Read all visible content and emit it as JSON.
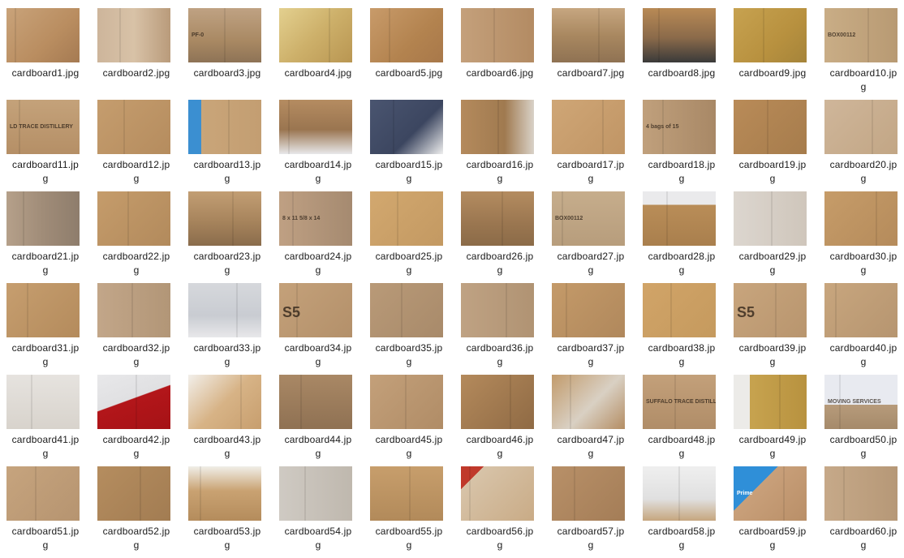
{
  "files": [
    {
      "name": "cardboard1.jpg",
      "bg": "linear-gradient(135deg,#c9a37a,#b98d60 60%,#a57a52)"
    },
    {
      "name": "cardboard2.jpg",
      "bg": "linear-gradient(90deg,#cdb59b,#d8c2a7 50%,#b99b7b)"
    },
    {
      "name": "cardboard3.jpg",
      "bg": "linear-gradient(180deg,#bfa283,#a98963 60%,#8e7356)",
      "text": "PF-0"
    },
    {
      "name": "cardboard4.jpg",
      "bg": "linear-gradient(135deg,#e3d08f,#cdb06a 50%,#b99652)"
    },
    {
      "name": "cardboard5.jpg",
      "bg": "linear-gradient(135deg,#c89b6a,#b3834f 60%,#a8784a)"
    },
    {
      "name": "cardboard6.jpg",
      "bg": "linear-gradient(90deg,#c4a07b,#b38b63)"
    },
    {
      "name": "cardboard7.jpg",
      "bg": "linear-gradient(180deg,#c6a680,#a98860 50%,#8f7253)"
    },
    {
      "name": "cardboard8.jpg",
      "bg": "linear-gradient(180deg,#b98a55,#8a6a4a 55%,#3a3a3a)"
    },
    {
      "name": "cardboard9.jpg",
      "bg": "linear-gradient(135deg,#c7a250,#b8913f 60%,#a5843a)"
    },
    {
      "name": "cardboard10.jpg",
      "bg": "linear-gradient(90deg,#c9ad86,#b89a73)",
      "text": "BOX00112"
    },
    {
      "name": "cardboard11.jpg",
      "bg": "linear-gradient(180deg,#c4a27a,#b58f66)",
      "text": "LD TRACE DISTILLERY"
    },
    {
      "name": "cardboard12.jpg",
      "bg": "linear-gradient(135deg,#c59d6e,#b58c5e)"
    },
    {
      "name": "cardboard13.jpg",
      "bg": "linear-gradient(90deg,#3b8fd1 0%,#3b8fd1 18%,#c9a579 18%,#c39e72)"
    },
    {
      "name": "cardboard14.jpg",
      "bg": "linear-gradient(180deg,#b58c61,#9a7550 55%,#e8e8ea)"
    },
    {
      "name": "cardboard15.jpg",
      "bg": "linear-gradient(135deg,#4a5570,#3c4660 60%,#eeeeee)"
    },
    {
      "name": "cardboard16.jpg",
      "bg": "linear-gradient(90deg,#b48a5c,#a07a50 60%,#d9d2c8)"
    },
    {
      "name": "cardboard17.jpg",
      "bg": "linear-gradient(135deg,#cfa676,#c09565)"
    },
    {
      "name": "cardboard18.jpg",
      "bg": "linear-gradient(90deg,#c0a07c,#a88866)",
      "text": "4 bags of 15"
    },
    {
      "name": "cardboard19.jpg",
      "bg": "linear-gradient(135deg,#b98b58,#a67c4c)"
    },
    {
      "name": "cardboard20.jpg",
      "bg": "linear-gradient(135deg,#cfb69a,#c2a685)"
    },
    {
      "name": "cardboard21.jpg",
      "bg": "linear-gradient(90deg,#b5a08a,#a08c78 50%,#8e7d6c)"
    },
    {
      "name": "cardboard22.jpg",
      "bg": "linear-gradient(135deg,#c59c6b,#b28a5c)"
    },
    {
      "name": "cardboard23.jpg",
      "bg": "linear-gradient(180deg,#c29e74,#a7845c 55%,#8a6c4c)"
    },
    {
      "name": "cardboard24.jpg",
      "bg": "linear-gradient(90deg,#bfa083,#a58a70)",
      "text": "8 x 11 5/8 x 14"
    },
    {
      "name": "cardboard25.jpg",
      "bg": "linear-gradient(135deg,#d2a86f,#c39962)"
    },
    {
      "name": "cardboard26.jpg",
      "bg": "linear-gradient(180deg,#b48c60,#9a7650 60%,#8b6b48)"
    },
    {
      "name": "cardboard27.jpg",
      "bg": "linear-gradient(180deg,#c6ad8c,#b79d7c)",
      "text": "BOX00112"
    },
    {
      "name": "cardboard28.jpg",
      "bg": "linear-gradient(180deg,#eaeaec 0%,#eaeaec 25%,#b98d58 25%,#a97f4d)"
    },
    {
      "name": "cardboard29.jpg",
      "bg": "linear-gradient(90deg,#dcd6cf,#cfc6bb)"
    },
    {
      "name": "cardboard30.jpg",
      "bg": "linear-gradient(135deg,#c69c69,#b58b5b)"
    },
    {
      "name": "cardboard31.jpg",
      "bg": "linear-gradient(135deg,#c69e6f,#b48b5c)"
    },
    {
      "name": "cardboard32.jpg",
      "bg": "linear-gradient(90deg,#c2a689,#b29677)"
    },
    {
      "name": "cardboard33.jpg",
      "bg": "linear-gradient(180deg,#d6d8dc,#c9ccd2 60%,#e8e8ea)"
    },
    {
      "name": "cardboard34.jpg",
      "bg": "linear-gradient(135deg,#c4a17a,#b3906a)",
      "text": "S5"
    },
    {
      "name": "cardboard35.jpg",
      "bg": "linear-gradient(135deg,#b99a78,#a88a6a)"
    },
    {
      "name": "cardboard36.jpg",
      "bg": "linear-gradient(90deg,#bfa283,#b09373)"
    },
    {
      "name": "cardboard37.jpg",
      "bg": "linear-gradient(135deg,#c49a69,#b0885c)"
    },
    {
      "name": "cardboard38.jpg",
      "bg": "linear-gradient(135deg,#d1a468,#c59a5e)"
    },
    {
      "name": "cardboard39.jpg",
      "bg": "linear-gradient(135deg,#c8a57d,#b8956e)",
      "text": "S5"
    },
    {
      "name": "cardboard40.jpg",
      "bg": "linear-gradient(135deg,#c8a67e,#b69570)"
    },
    {
      "name": "cardboard41.jpg",
      "bg": "linear-gradient(180deg,#e6e3df,#d8d3cc)"
    },
    {
      "name": "cardboard42.jpg",
      "bg": "linear-gradient(160deg,#e8e8ea 0%,#e0e0e2 45%,#b3161a 46%,#a51216)"
    },
    {
      "name": "cardboard43.jpg",
      "bg": "linear-gradient(135deg,#f2efea,#d7b386 50%,#c79e6e)"
    },
    {
      "name": "cardboard44.jpg",
      "bg": "linear-gradient(180deg,#a98865,#8f7153)"
    },
    {
      "name": "cardboard45.jpg",
      "bg": "linear-gradient(135deg,#c3a07a,#b08c66)"
    },
    {
      "name": "cardboard46.jpg",
      "bg": "linear-gradient(135deg,#b48a5c,#8f6a44)"
    },
    {
      "name": "cardboard47.jpg",
      "bg": "linear-gradient(135deg,#c29b6c,#d9d0c3 55%,#b48d63)"
    },
    {
      "name": "cardboard48.jpg",
      "bg": "linear-gradient(180deg,#c3a07a,#b08d68)",
      "text": "SUFFALO TRACE DISTILLERY"
    },
    {
      "name": "cardboard49.jpg",
      "bg": "linear-gradient(90deg,#ecebe8 0%,#ecebe8 22%,#c7a34f 22%,#b8923f)"
    },
    {
      "name": "cardboard50.jpg",
      "bg": "linear-gradient(180deg,#e8eaf0 0%,#e8eaf0 55%,#b79b7b 55%,#a58a6a)",
      "text": "MOVING SERVICES"
    },
    {
      "name": "cardboard51.jpg",
      "bg": "linear-gradient(135deg,#c6a47e,#b69470)"
    },
    {
      "name": "cardboard52.jpg",
      "bg": "linear-gradient(135deg,#b58d5f,#a27c52)"
    },
    {
      "name": "cardboard53.jpg",
      "bg": "linear-gradient(180deg,#f0eee8,#c9a272 45%,#b48c5c)"
    },
    {
      "name": "cardboard54.jpg",
      "bg": "linear-gradient(90deg,#cfcac3,#bfb8ae)"
    },
    {
      "name": "cardboard55.jpg",
      "bg": "linear-gradient(180deg,#c79e6c,#b28a5a)"
    },
    {
      "name": "cardboard56.jpg",
      "bg": "linear-gradient(135deg,#c0392b 0%,#c0392b 18%,#d7c3a8 18%,#c9ab86)"
    },
    {
      "name": "cardboard57.jpg",
      "bg": "linear-gradient(135deg,#b89068,#a47d57)"
    },
    {
      "name": "cardboard58.jpg",
      "bg": "linear-gradient(180deg,#efefef,#e0e0e0 60%,#c6a67e)"
    },
    {
      "name": "cardboard59.jpg",
      "bg": "linear-gradient(135deg,#2f8fd8 0%,#2f8fd8 35%,#c9a07a 35%,#b98f68)",
      "text": "Prime"
    },
    {
      "name": "cardboard60.jpg",
      "bg": "linear-gradient(90deg,#c6a989,#b69877)"
    }
  ]
}
